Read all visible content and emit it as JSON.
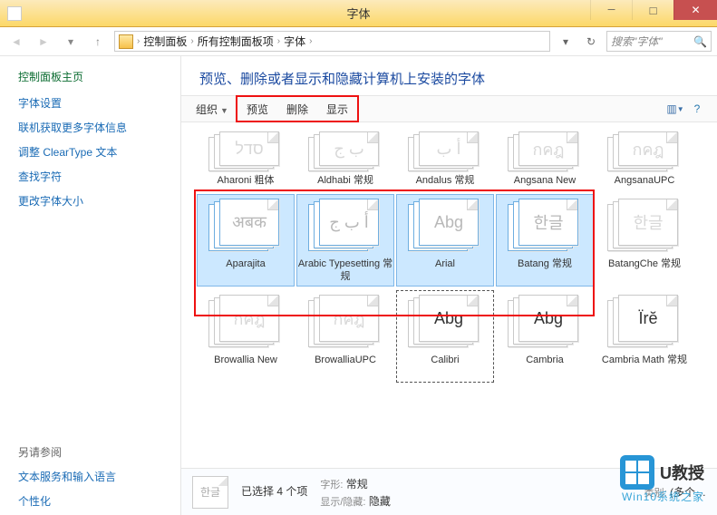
{
  "window": {
    "title": "字体"
  },
  "breadcrumb": {
    "l1": "控制面板",
    "l2": "所有控制面板项",
    "l3": "字体"
  },
  "search": {
    "placeholder": "搜索\"字体\""
  },
  "sidebar": {
    "heading": "控制面板主页",
    "links": [
      "字体设置",
      "联机获取更多字体信息",
      "调整 ClearType 文本",
      "查找字符",
      "更改字体大小"
    ],
    "seealso_heading": "另请参阅",
    "seealso": [
      "文本服务和输入语言",
      "个性化"
    ]
  },
  "header": {
    "text": "预览、删除或者显示和隐藏计算机上安装的字体"
  },
  "toolbar": {
    "organize": "组织",
    "preview": "预览",
    "delete": "删除",
    "show": "显示"
  },
  "fonts": {
    "row0": [
      {
        "label": "Aharoni 粗体",
        "sample": "סדל"
      },
      {
        "label": "Aldhabi 常规",
        "sample": "ب ج"
      },
      {
        "label": "Andalus 常规",
        "sample": "أ ب"
      },
      {
        "label": "Angsana New",
        "sample": "กคฎ"
      },
      {
        "label": "AngsanaUPC",
        "sample": "กคฎ"
      }
    ],
    "row1": [
      {
        "label": "Aparajita",
        "sample": "अबक",
        "selected": true
      },
      {
        "label": "Arabic Typesetting 常规",
        "sample": "أ ب ج",
        "selected": true
      },
      {
        "label": "Arial",
        "sample": "Abg",
        "selected": true
      },
      {
        "label": "Batang 常规",
        "sample": "한글",
        "selected": true
      },
      {
        "label": "BatangChe 常规",
        "sample": "한글"
      }
    ],
    "row2": [
      {
        "label": "Browallia New",
        "sample": "กคฎ"
      },
      {
        "label": "BrowalliaUPC",
        "sample": "กคฎ"
      },
      {
        "label": "Calibri",
        "sample": "Abg",
        "focus": true,
        "dark": true
      },
      {
        "label": "Cambria",
        "sample": "Abg",
        "dark": true
      },
      {
        "label": "Cambria Math 常规",
        "sample": "Ïrĕ",
        "dark": true
      }
    ]
  },
  "details": {
    "sample": "한글",
    "selection": "已选择 4 个项",
    "style_label": "字形:",
    "style_value": "常规",
    "showhide_label": "显示/隐藏:",
    "showhide_value": "隐藏",
    "category_label": "类别:",
    "category_value": "(多个…"
  },
  "watermark": {
    "brand": "U教授",
    "sub": "Win10系统之家"
  }
}
